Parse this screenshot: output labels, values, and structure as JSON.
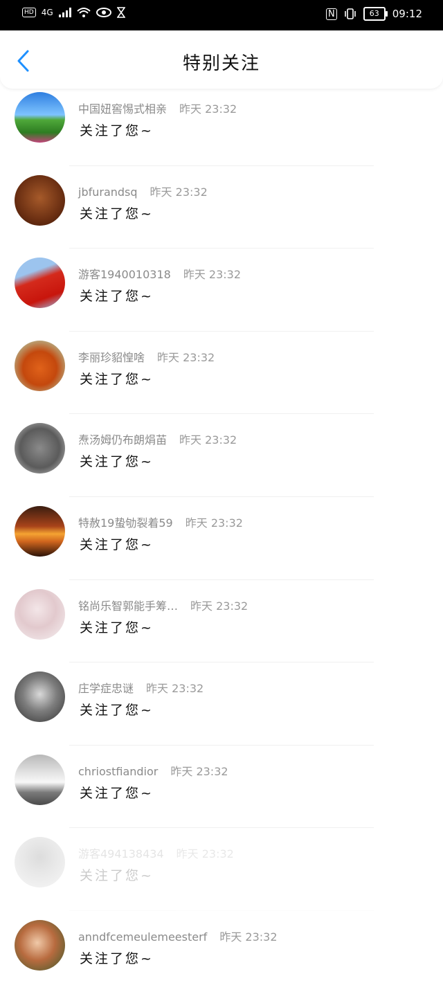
{
  "status_bar": {
    "network": "4G",
    "battery": "63",
    "time": "09:12"
  },
  "header": {
    "title": "特别关注"
  },
  "items": [
    {
      "name": "中国妞窖惕式相亲",
      "time": "昨天  23:32",
      "message": "关注了您~"
    },
    {
      "name": "jbfurandsq",
      "time": "昨天  23:32",
      "message": "关注了您~"
    },
    {
      "name": "游客1940010318",
      "time": "昨天  23:32",
      "message": "关注了您~"
    },
    {
      "name": "李丽珍貂惶啥",
      "time": "昨天  23:32",
      "message": "关注了您~"
    },
    {
      "name": "焘汤姆仍布朗焆苖",
      "time": "昨天  23:32",
      "message": "关注了您~"
    },
    {
      "name": "特赦19蛰劬裂着59",
      "time": "昨天  23:32",
      "message": "关注了您~"
    },
    {
      "name": "铭尚乐智郭能手筹…",
      "time": "昨天  23:32",
      "message": "关注了您~"
    },
    {
      "name": "庄学症忠谜",
      "time": "昨天  23:32",
      "message": "关注了您~"
    },
    {
      "name": "chriostfiandior",
      "time": "昨天  23:32",
      "message": "关注了您~"
    },
    {
      "name": "游客494138434",
      "time": "昨天  23:32",
      "message": "关注了您~"
    },
    {
      "name": "anndfcemeulemeesterf",
      "time": "昨天  23:32",
      "message": "关注了您~"
    }
  ],
  "colors": {
    "accent": "#1e90ff",
    "statusbar": "#000000"
  }
}
